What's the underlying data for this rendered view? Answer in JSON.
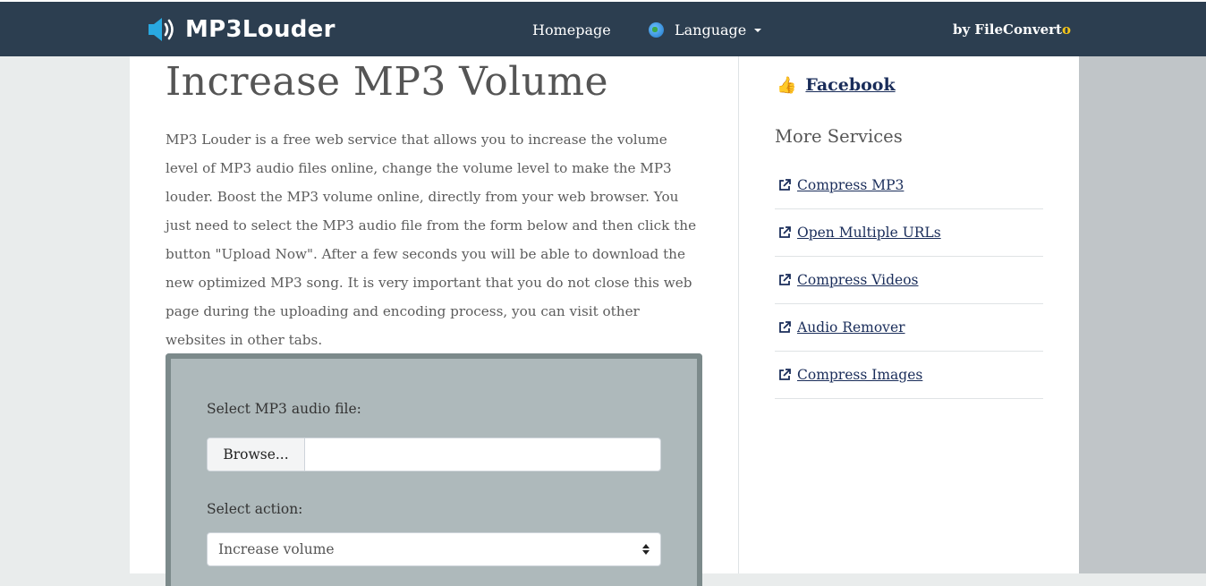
{
  "header": {
    "logo_text": "MP3Louder",
    "nav": {
      "homepage": "Homepage",
      "language": "Language"
    },
    "by_prefix": "by FileConvert",
    "by_suffix": "o"
  },
  "main": {
    "title": "Increase MP3 Volume",
    "intro": "MP3 Louder is a free web service that allows you to increase the volume level of MP3 audio files online, change the volume level to make the MP3 louder. Boost the MP3 volume online, directly from your web browser. You just need to select the MP3 audio file from the form below and then click the button \"Upload Now\". After a few seconds you will be able to download the new optimized MP3 song. It is very important that you do not close this web page during the uploading and encoding process, you can visit other websites in other tabs.",
    "form": {
      "file_label": "Select MP3 audio file:",
      "browse_label": "Browse...",
      "action_label": "Select action:",
      "action_selected": "Increase volume"
    }
  },
  "sidebar": {
    "facebook": "Facebook",
    "more_services_title": "More Services",
    "services": [
      {
        "label": " Compress MP3"
      },
      {
        "label": " Open Multiple URLs"
      },
      {
        "label": " Compress Videos"
      },
      {
        "label": " Audio Remover"
      },
      {
        "label": " Compress Images"
      }
    ]
  },
  "icons": {
    "logo": "speaker-icon",
    "language": "globe-icon",
    "facebook": "thumbs-up-icon",
    "service": "external-link-icon"
  },
  "colors": {
    "header_bg": "#2c3e50",
    "accent": "#f5c518",
    "link": "#1a2d5a",
    "form_bg": "#aeb9bb"
  }
}
